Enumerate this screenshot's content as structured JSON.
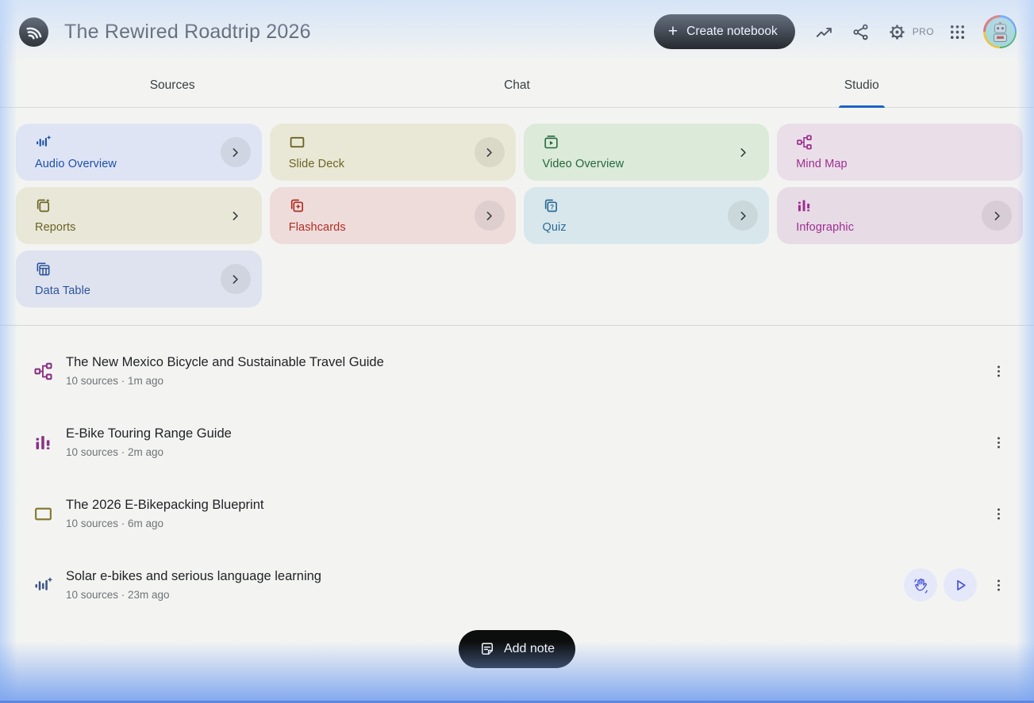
{
  "header": {
    "title": "The Rewired Roadtrip 2026",
    "create_notebook_label": "Create notebook",
    "pro_badge": "PRO"
  },
  "tabs": [
    {
      "label": "Sources",
      "active": false
    },
    {
      "label": "Chat",
      "active": false
    },
    {
      "label": "Studio",
      "active": true
    }
  ],
  "studio_tools": [
    {
      "label": "Audio Overview",
      "icon": "audio-waveform-sparkle-icon",
      "bg": "#dfe4f5",
      "fg": "#1c51a4",
      "chevron": "circle"
    },
    {
      "label": "Slide Deck",
      "icon": "slide-deck-icon",
      "bg": "#e9e8d6",
      "fg": "#6a6423",
      "chevron": "circle"
    },
    {
      "label": "Video Overview",
      "icon": "video-overview-icon",
      "bg": "#dcead9",
      "fg": "#23683a",
      "chevron": "plain"
    },
    {
      "label": "Mind Map",
      "icon": "mind-map-icon",
      "bg": "#eadfe8",
      "fg": "#9d2f92",
      "chevron": "none"
    },
    {
      "label": "Reports",
      "icon": "reports-icon",
      "bg": "#e8e7d8",
      "fg": "#6a6423",
      "chevron": "plain"
    },
    {
      "label": "Flashcards",
      "icon": "flashcards-icon",
      "bg": "#eedcdb",
      "fg": "#b02d24",
      "chevron": "circle"
    },
    {
      "label": "Quiz",
      "icon": "quiz-icon",
      "bg": "#d8e7ec",
      "fg": "#2b6a93",
      "chevron": "circle"
    },
    {
      "label": "Infographic",
      "icon": "infographic-bars-icon",
      "bg": "#e7dbe5",
      "fg": "#9d2f92",
      "chevron": "circle"
    },
    {
      "label": "Data Table",
      "icon": "data-table-icon",
      "bg": "#dfe3ef",
      "fg": "#2d549e",
      "chevron": "circle"
    }
  ],
  "artifacts": [
    {
      "icon": "mind-map-icon",
      "icon_color": "#8a3185",
      "title": "The New Mexico Bicycle and Sustainable Travel Guide",
      "meta": "10 sources · 1m ago",
      "actions": [
        "more"
      ]
    },
    {
      "icon": "infographic-bars-icon",
      "icon_color": "#8a3185",
      "title": "E-Bike Touring Range Guide",
      "meta": "10 sources · 2m ago",
      "actions": [
        "more"
      ]
    },
    {
      "icon": "slide-deck-icon",
      "icon_color": "#877b33",
      "title": "The 2026 E-Bikepacking Blueprint",
      "meta": "10 sources · 6m ago",
      "actions": [
        "more"
      ]
    },
    {
      "icon": "audio-waveform-sparkle-icon",
      "icon_color": "#3a5382",
      "title": "Solar e-bikes and serious language learning",
      "meta": "10 sources · 23m ago",
      "actions": [
        "interactive",
        "play",
        "more"
      ]
    }
  ],
  "footer": {
    "add_note_label": "Add note"
  },
  "colors": {
    "tab_underline": "#1a63c6",
    "create_button_bg": "#0c0d0d",
    "add_note_button_bg": "#0c0d0d",
    "action_button_bg": "#e5e8f8",
    "action_button_icon": "#4b57dd",
    "edge_glow_blue": "#7aa3ee",
    "page_bg": "#f3f4f2"
  }
}
